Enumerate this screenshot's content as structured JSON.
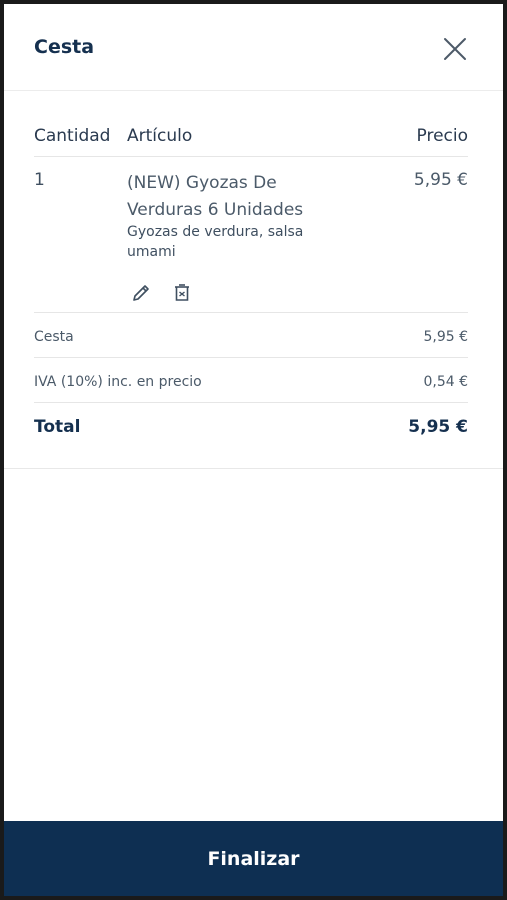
{
  "cart": {
    "title": "Cesta",
    "columns": {
      "quantity": "Cantidad",
      "article": "Artículo",
      "price": "Precio"
    },
    "items": [
      {
        "quantity": "1",
        "name": "(NEW) Gyozas De Verduras 6 Unidades",
        "description": "Gyozas de verdura, salsa umami",
        "price": "5,95 €"
      }
    ],
    "summary": {
      "subtotal_label": "Cesta",
      "subtotal_value": "5,95 €",
      "tax_label": "IVA (10%) inc. en precio",
      "tax_value": "0,54 €",
      "total_label": "Total",
      "total_value": "5,95 €"
    },
    "finalize_label": "Finalizar"
  },
  "icons": {
    "close": "close-icon",
    "edit": "pencil-icon",
    "delete": "trash-icon"
  },
  "colors": {
    "brand": "#0e2f52"
  }
}
